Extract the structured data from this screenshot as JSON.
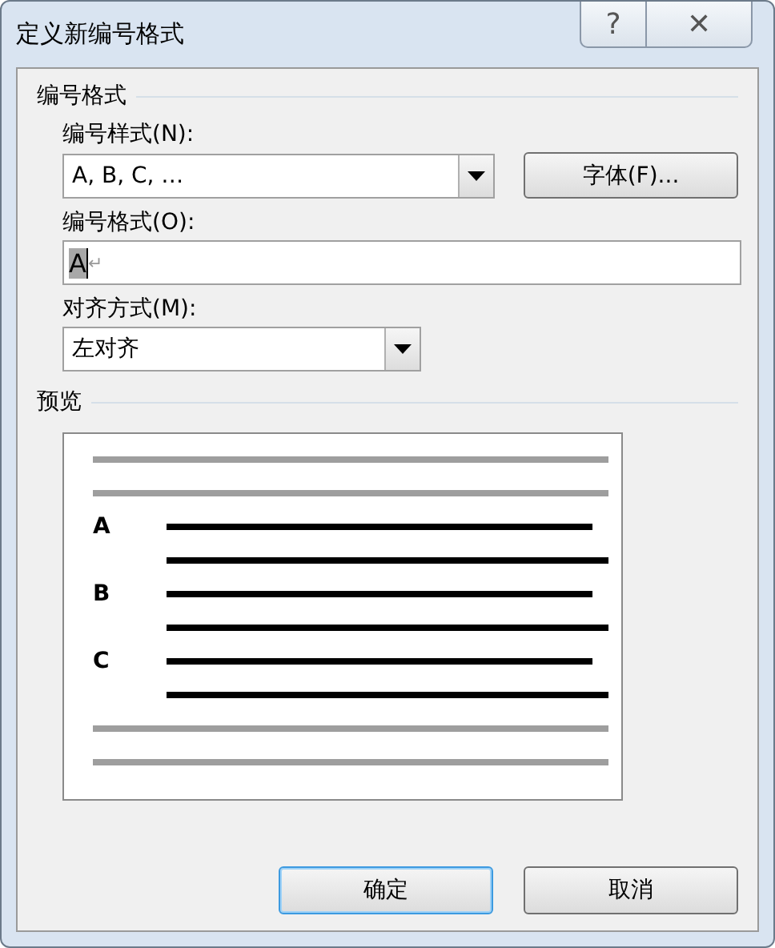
{
  "window": {
    "title": "定义新编号格式",
    "help_button": "?",
    "close_button": "✕"
  },
  "number_format_group": {
    "title": "编号格式",
    "number_style": {
      "label": "编号样式(N):",
      "value": "A, B, C, …",
      "button": "字体(F)..."
    },
    "number_format": {
      "label": "编号格式(O):",
      "value": "A",
      "paragraph_mark": "↵"
    },
    "alignment": {
      "label": "对齐方式(M):",
      "value": "左对齐"
    }
  },
  "preview": {
    "title": "预览",
    "items": [
      {
        "label": "A"
      },
      {
        "label": "B"
      },
      {
        "label": "C"
      }
    ]
  },
  "buttons": [
    {
      "label": "确定",
      "focused": true
    },
    {
      "label": "取消",
      "focused": false
    }
  ]
}
